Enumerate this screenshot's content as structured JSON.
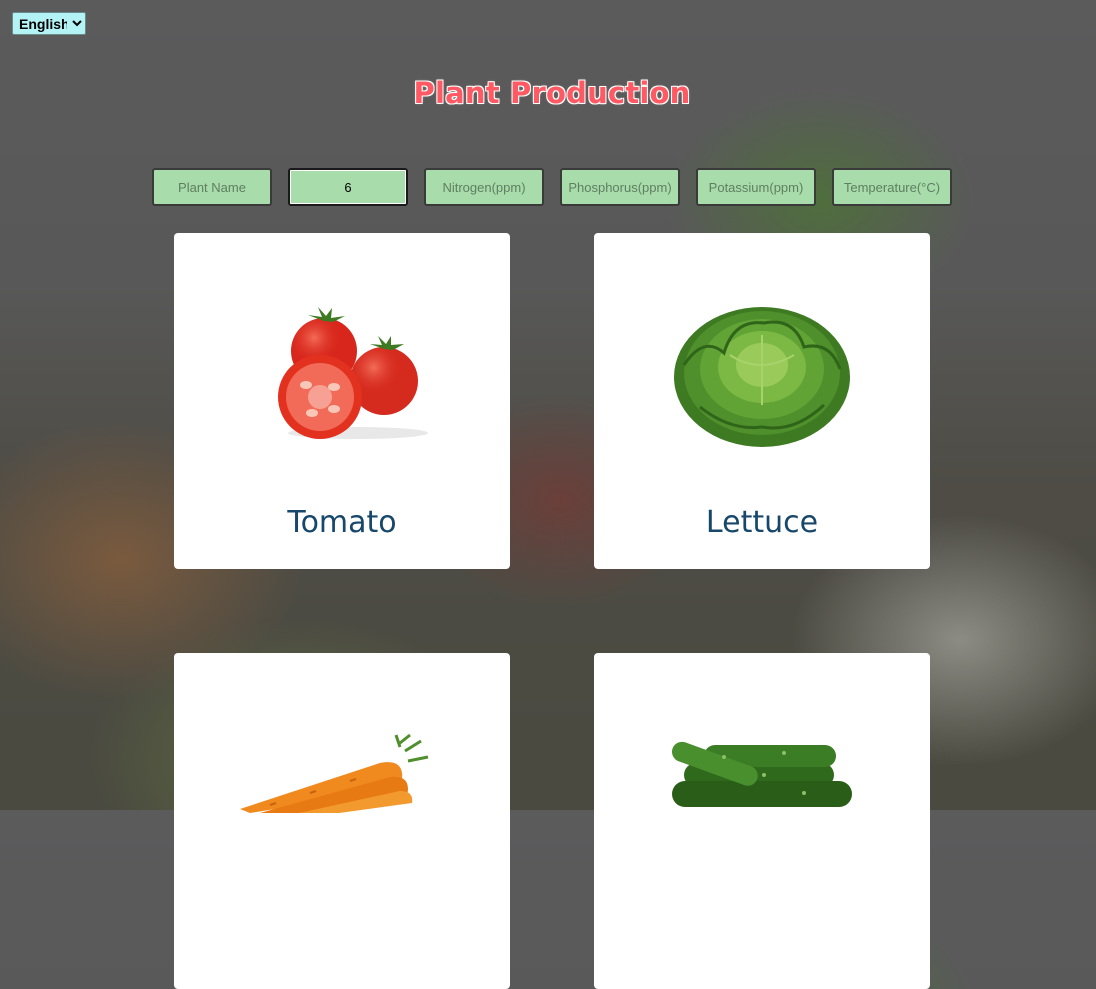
{
  "language_selector": {
    "selected": "English"
  },
  "page_title": "Plant Production",
  "filters": {
    "plant_name": {
      "placeholder": "Plant Name",
      "value": ""
    },
    "quantity": {
      "placeholder": "",
      "value": "6"
    },
    "nitrogen": {
      "placeholder": "Nitrogen(ppm)",
      "value": ""
    },
    "phosphorus": {
      "placeholder": "Phosphorus(ppm)",
      "value": ""
    },
    "potassium": {
      "placeholder": "Potassium(ppm)",
      "value": ""
    },
    "temperature": {
      "placeholder": "Temperature(°C)",
      "value": ""
    }
  },
  "plants": [
    {
      "name": "Tomato",
      "image": "tomato-image"
    },
    {
      "name": "Lettuce",
      "image": "lettuce-image"
    },
    {
      "name": "",
      "image": "carrot-image"
    },
    {
      "name": "",
      "image": "cucumber-image"
    }
  ],
  "colors": {
    "title": "#ff5a64",
    "input_background": "#a8dcaa",
    "card_label": "#17476a",
    "language_selector_background": "#b3f2f5"
  }
}
